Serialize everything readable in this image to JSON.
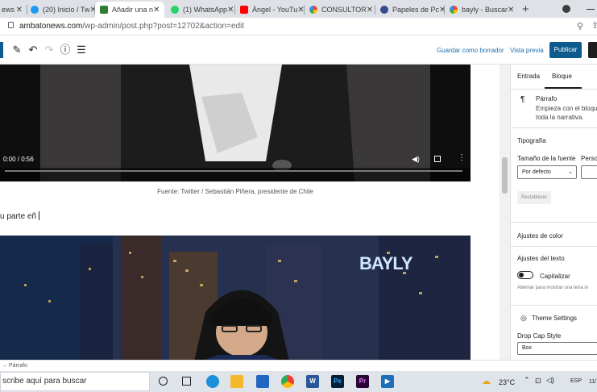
{
  "browser": {
    "tabs": [
      {
        "title": "ews",
        "icon": "blank-icon"
      },
      {
        "title": "(20) Inicio / Tw",
        "icon": "twitter-icon"
      },
      {
        "title": "Añadir una n",
        "icon": "wordpress-icon"
      },
      {
        "title": "(1) WhatsApp",
        "icon": "whatsapp-icon"
      },
      {
        "title": "Ángel - YouTu",
        "icon": "youtube-icon"
      },
      {
        "title": "CONSULTOR",
        "icon": "google-icon"
      },
      {
        "title": "Papeles de Pc",
        "icon": "papeles-icon"
      },
      {
        "title": "bayly - Buscar",
        "icon": "google-icon"
      }
    ],
    "new_tab": "+",
    "url_domain": "ambatonews.com",
    "url_path": "/wp-admin/post.php?post=12702&action=edit"
  },
  "toolbar": {
    "save_draft": "Guardar como borrador",
    "preview": "Vista previa",
    "publish": "Publicar"
  },
  "content": {
    "video_time": "0:00 / 0:56",
    "caption": "Fuente: Twitter / Sebastián Piñera, presidente de Chile",
    "paragraph": "u parte eñ",
    "bayly_sign": "BAYLY"
  },
  "sidebar": {
    "tab_entry": "Entrada",
    "tab_block": "Bloque",
    "block_name": "Párrafo",
    "block_desc_1": "Empieza con el bloque c",
    "block_desc_2": "toda la narrativa.",
    "typography": "Tipografía",
    "font_size_label": "Tamaño de la fuente",
    "custom_label": "Perso",
    "font_size_value": "Por defecto",
    "reset": "Restablecer",
    "color_settings": "Ajustes de color",
    "text_settings": "Ajustes del texto",
    "capitalize": "Capitalizar",
    "capitalize_help": "Alternar para mostrar una letra in",
    "theme_settings": "Theme Settings",
    "drop_cap_label": "Drop Cap Style",
    "drop_cap_value": "Box"
  },
  "breadcrumb": "→ Párrafo",
  "taskbar": {
    "search": "scribe aquí para buscar",
    "temp": "23°C",
    "lang": "ESP",
    "time": "11/"
  }
}
